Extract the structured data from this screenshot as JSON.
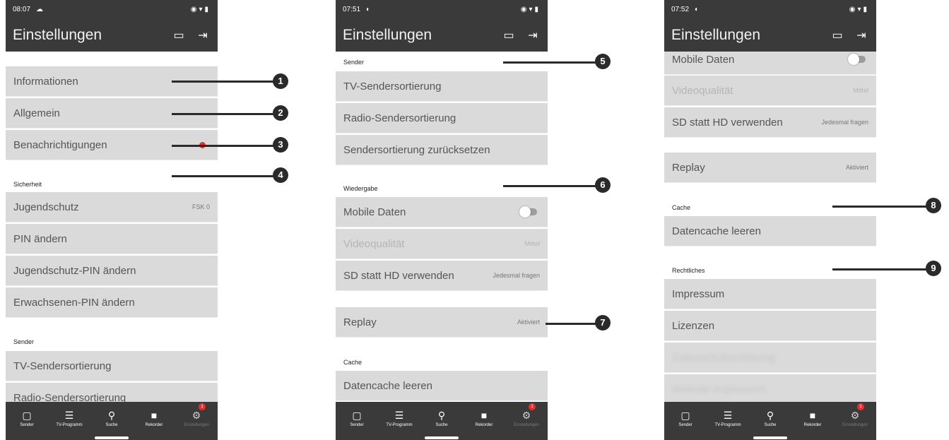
{
  "app": {
    "title": "Einstellungen",
    "icons": [
      "cast-icon",
      "logout-icon"
    ],
    "bottom_nav": [
      "Sender",
      "TV-Programm",
      "Suche",
      "Rekorder",
      "Einstellungen"
    ],
    "badge": "1"
  },
  "screens": [
    {
      "time": "08:07",
      "rows": [
        {
          "label": "Informationen"
        },
        {
          "label": "Allgemein"
        },
        {
          "label": "Benachrichtigungen"
        },
        {
          "section": "Sicherheit"
        },
        {
          "label": "Jugendschutz",
          "value": "FSK 0"
        },
        {
          "label": "PIN ändern"
        },
        {
          "label": "Jugendschutz-PIN ändern"
        },
        {
          "label": "Erwachsenen-PIN ändern"
        },
        {
          "section": "Sender"
        },
        {
          "label": "TV-Sendersortierung"
        },
        {
          "label": "Radio-Sendersortierung"
        }
      ]
    },
    {
      "time": "07:51",
      "rows": [
        {
          "section": "Sender"
        },
        {
          "label": "TV-Sendersortierung"
        },
        {
          "label": "Radio-Sendersortierung"
        },
        {
          "label": "Sendersortierung zurücksetzen"
        },
        {
          "section": "Wiedergabe"
        },
        {
          "label": "Mobile Daten",
          "toggle": false
        },
        {
          "label": "Videoqualität",
          "value": "Mittel",
          "disabled": true
        },
        {
          "label": "SD statt HD verwenden",
          "value": "Jedesmal fragen"
        },
        {
          "label": "Replay",
          "value": "Aktiviert"
        },
        {
          "section": "Cache"
        },
        {
          "label": "Datencache leeren"
        }
      ]
    },
    {
      "time": "07:52",
      "rows": [
        {
          "label": "Mobile Daten",
          "toggle": false
        },
        {
          "label": "Videoqualität",
          "value": "Mittel",
          "disabled": true
        },
        {
          "label": "SD statt HD verwenden",
          "value": "Jedesmal fragen"
        },
        {
          "label": "Replay",
          "value": "Aktiviert"
        },
        {
          "section": "Cache"
        },
        {
          "label": "Datencache leeren"
        },
        {
          "section": "Rechtliches"
        },
        {
          "label": "Impressum"
        },
        {
          "label": "Lizenzen"
        },
        {
          "label": "Datenschutzerklärung",
          "blurred": true
        },
        {
          "label": "Website-Impressum",
          "blurred": true
        }
      ]
    }
  ],
  "callouts": [
    "1",
    "2",
    "3",
    "4",
    "5",
    "6",
    "7",
    "8",
    "9"
  ],
  "colors": {
    "bar": "#3a3a3a",
    "row": "#dadada",
    "badge": "#e53030"
  }
}
